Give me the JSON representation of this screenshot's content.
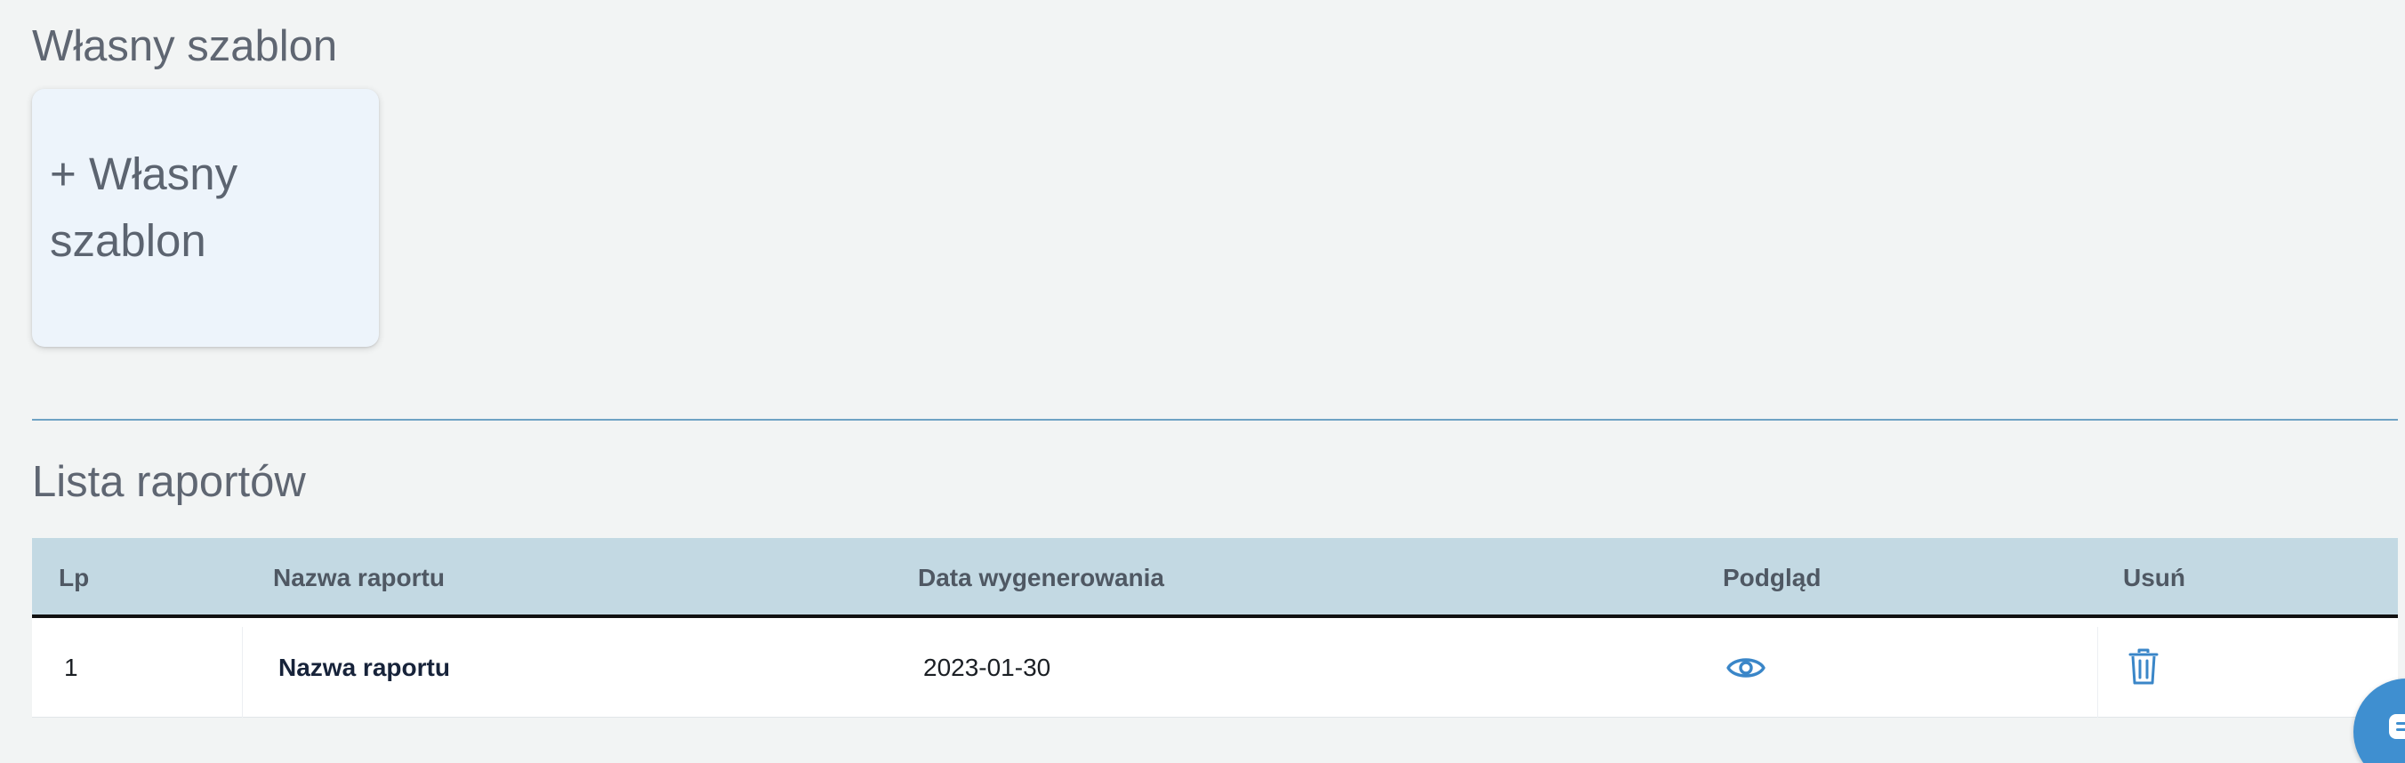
{
  "custom_template": {
    "title": "Własny szablon",
    "card_label": "+ Własny szablon"
  },
  "reports": {
    "title": "Lista raportów",
    "columns": {
      "lp": "Lp",
      "name": "Nazwa raportu",
      "date": "Data wygenerowania",
      "preview": "Podgląd",
      "delete": "Usuń"
    },
    "rows": [
      {
        "lp": "1",
        "name": "Nazwa raportu",
        "date": "2023-01-30",
        "preview_icon": "eye-icon",
        "delete_icon": "trash-icon"
      }
    ]
  },
  "chat_widget": {
    "icon": "chat-icon",
    "color": "#3f8fd0"
  },
  "colors": {
    "accent": "#3a86c8",
    "table_header_bg": "#c3d9e3",
    "divider": "#6fa3c4",
    "card_bg": "#edf4fb",
    "page_bg": "#f2f4f4"
  }
}
